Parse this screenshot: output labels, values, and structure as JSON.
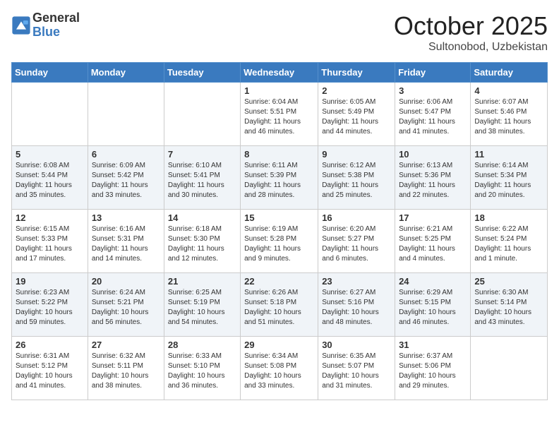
{
  "logo": {
    "general": "General",
    "blue": "Blue"
  },
  "title": "October 2025",
  "location": "Sultonobod, Uzbekistan",
  "weekdays": [
    "Sunday",
    "Monday",
    "Tuesday",
    "Wednesday",
    "Thursday",
    "Friday",
    "Saturday"
  ],
  "weeks": [
    [
      {
        "day": "",
        "info": ""
      },
      {
        "day": "",
        "info": ""
      },
      {
        "day": "",
        "info": ""
      },
      {
        "day": "1",
        "info": "Sunrise: 6:04 AM\nSunset: 5:51 PM\nDaylight: 11 hours and 46 minutes."
      },
      {
        "day": "2",
        "info": "Sunrise: 6:05 AM\nSunset: 5:49 PM\nDaylight: 11 hours and 44 minutes."
      },
      {
        "day": "3",
        "info": "Sunrise: 6:06 AM\nSunset: 5:47 PM\nDaylight: 11 hours and 41 minutes."
      },
      {
        "day": "4",
        "info": "Sunrise: 6:07 AM\nSunset: 5:46 PM\nDaylight: 11 hours and 38 minutes."
      }
    ],
    [
      {
        "day": "5",
        "info": "Sunrise: 6:08 AM\nSunset: 5:44 PM\nDaylight: 11 hours and 35 minutes."
      },
      {
        "day": "6",
        "info": "Sunrise: 6:09 AM\nSunset: 5:42 PM\nDaylight: 11 hours and 33 minutes."
      },
      {
        "day": "7",
        "info": "Sunrise: 6:10 AM\nSunset: 5:41 PM\nDaylight: 11 hours and 30 minutes."
      },
      {
        "day": "8",
        "info": "Sunrise: 6:11 AM\nSunset: 5:39 PM\nDaylight: 11 hours and 28 minutes."
      },
      {
        "day": "9",
        "info": "Sunrise: 6:12 AM\nSunset: 5:38 PM\nDaylight: 11 hours and 25 minutes."
      },
      {
        "day": "10",
        "info": "Sunrise: 6:13 AM\nSunset: 5:36 PM\nDaylight: 11 hours and 22 minutes."
      },
      {
        "day": "11",
        "info": "Sunrise: 6:14 AM\nSunset: 5:34 PM\nDaylight: 11 hours and 20 minutes."
      }
    ],
    [
      {
        "day": "12",
        "info": "Sunrise: 6:15 AM\nSunset: 5:33 PM\nDaylight: 11 hours and 17 minutes."
      },
      {
        "day": "13",
        "info": "Sunrise: 6:16 AM\nSunset: 5:31 PM\nDaylight: 11 hours and 14 minutes."
      },
      {
        "day": "14",
        "info": "Sunrise: 6:18 AM\nSunset: 5:30 PM\nDaylight: 11 hours and 12 minutes."
      },
      {
        "day": "15",
        "info": "Sunrise: 6:19 AM\nSunset: 5:28 PM\nDaylight: 11 hours and 9 minutes."
      },
      {
        "day": "16",
        "info": "Sunrise: 6:20 AM\nSunset: 5:27 PM\nDaylight: 11 hours and 6 minutes."
      },
      {
        "day": "17",
        "info": "Sunrise: 6:21 AM\nSunset: 5:25 PM\nDaylight: 11 hours and 4 minutes."
      },
      {
        "day": "18",
        "info": "Sunrise: 6:22 AM\nSunset: 5:24 PM\nDaylight: 11 hours and 1 minute."
      }
    ],
    [
      {
        "day": "19",
        "info": "Sunrise: 6:23 AM\nSunset: 5:22 PM\nDaylight: 10 hours and 59 minutes."
      },
      {
        "day": "20",
        "info": "Sunrise: 6:24 AM\nSunset: 5:21 PM\nDaylight: 10 hours and 56 minutes."
      },
      {
        "day": "21",
        "info": "Sunrise: 6:25 AM\nSunset: 5:19 PM\nDaylight: 10 hours and 54 minutes."
      },
      {
        "day": "22",
        "info": "Sunrise: 6:26 AM\nSunset: 5:18 PM\nDaylight: 10 hours and 51 minutes."
      },
      {
        "day": "23",
        "info": "Sunrise: 6:27 AM\nSunset: 5:16 PM\nDaylight: 10 hours and 48 minutes."
      },
      {
        "day": "24",
        "info": "Sunrise: 6:29 AM\nSunset: 5:15 PM\nDaylight: 10 hours and 46 minutes."
      },
      {
        "day": "25",
        "info": "Sunrise: 6:30 AM\nSunset: 5:14 PM\nDaylight: 10 hours and 43 minutes."
      }
    ],
    [
      {
        "day": "26",
        "info": "Sunrise: 6:31 AM\nSunset: 5:12 PM\nDaylight: 10 hours and 41 minutes."
      },
      {
        "day": "27",
        "info": "Sunrise: 6:32 AM\nSunset: 5:11 PM\nDaylight: 10 hours and 38 minutes."
      },
      {
        "day": "28",
        "info": "Sunrise: 6:33 AM\nSunset: 5:10 PM\nDaylight: 10 hours and 36 minutes."
      },
      {
        "day": "29",
        "info": "Sunrise: 6:34 AM\nSunset: 5:08 PM\nDaylight: 10 hours and 33 minutes."
      },
      {
        "day": "30",
        "info": "Sunrise: 6:35 AM\nSunset: 5:07 PM\nDaylight: 10 hours and 31 minutes."
      },
      {
        "day": "31",
        "info": "Sunrise: 6:37 AM\nSunset: 5:06 PM\nDaylight: 10 hours and 29 minutes."
      },
      {
        "day": "",
        "info": ""
      }
    ]
  ]
}
